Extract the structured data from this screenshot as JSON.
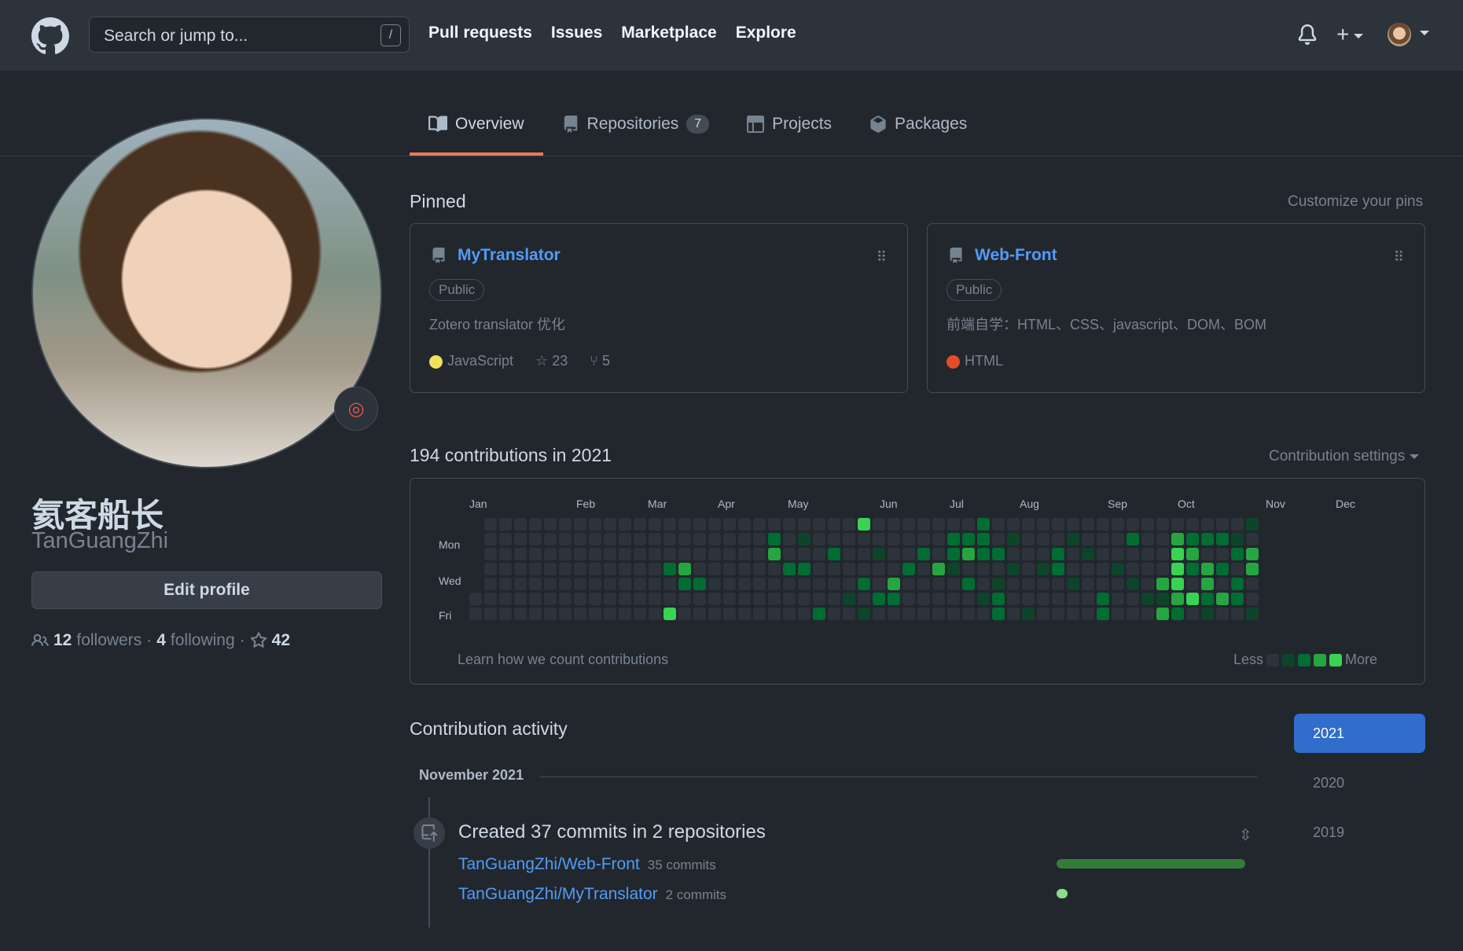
{
  "topnav": {
    "search_placeholder": "Search or jump to...",
    "slash_hint": "/",
    "links": [
      "Pull requests",
      "Issues",
      "Marketplace",
      "Explore"
    ]
  },
  "tabs": [
    {
      "label": "Overview",
      "icon": "book-icon"
    },
    {
      "label": "Repositories",
      "icon": "repo-icon",
      "count": "7"
    },
    {
      "label": "Projects",
      "icon": "table-icon"
    },
    {
      "label": "Packages",
      "icon": "package-icon"
    }
  ],
  "profile": {
    "name": "氦客船长",
    "login": "TanGuangZhi",
    "edit_label": "Edit profile",
    "followers_count": "12",
    "followers_label": "followers",
    "following_count": "4",
    "following_label": "following",
    "stars_count": "42"
  },
  "pinned": {
    "title": "Pinned",
    "customize": "Customize your pins",
    "items": [
      {
        "name": "MyTranslator",
        "visibility": "Public",
        "description": "Zotero translator 优化",
        "language": "JavaScript",
        "lang_color": "#f1e05a",
        "stars": "23",
        "forks": "5"
      },
      {
        "name": "Web-Front",
        "visibility": "Public",
        "description": "前端自学：HTML、CSS、javascript、DOM、BOM",
        "language": "HTML",
        "lang_color": "#e34c26"
      }
    ]
  },
  "contributions": {
    "title": "194 contributions in 2021",
    "settings": "Contribution settings",
    "months": [
      "Jan",
      "Feb",
      "Mar",
      "Apr",
      "May",
      "Jun",
      "Jul",
      "Aug",
      "Sep",
      "Oct",
      "Nov",
      "Dec"
    ],
    "days": [
      "Mon",
      "Wed",
      "Fri"
    ],
    "learn": "Learn how we count contributions",
    "less": "Less",
    "more": "More"
  },
  "activity": {
    "title": "Contribution activity",
    "years": [
      "2021",
      "2020",
      "2019"
    ],
    "month": "November 2021",
    "summary": "Created 37 commits in 2 repositories",
    "repos": [
      {
        "name": "TanGuangZhi/Web-Front",
        "commits": "35 commits",
        "count": 35
      },
      {
        "name": "TanGuangZhi/MyTranslator",
        "commits": "2 commits",
        "count": 2
      }
    ]
  },
  "colors": {
    "accent_blue": "#539bf5",
    "tab_underline": "#ec775c",
    "green_levels": [
      "#2d333b",
      "#0e4429",
      "#006d32",
      "#26a641",
      "#39d353"
    ]
  }
}
